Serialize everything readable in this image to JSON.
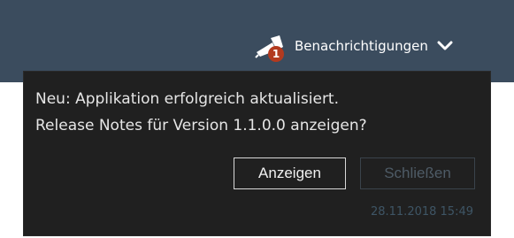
{
  "header": {
    "notifications_label": "Benachrichtigungen",
    "badge_count": "1",
    "bell_icon": "bell-icon",
    "chevron_icon": "chevron-down-icon",
    "background_color": "#3b4c5e"
  },
  "notification": {
    "line1": "Neu: Applikation erfolgreich aktualisiert.",
    "line2": "Release Notes für Version 1.1.0.0 anzeigen?",
    "show_button": "Anzeigen",
    "close_button": "Schließen",
    "timestamp": "28.11.2018 15:49",
    "background_color": "#202020",
    "badge_color": "#b23a1f"
  }
}
